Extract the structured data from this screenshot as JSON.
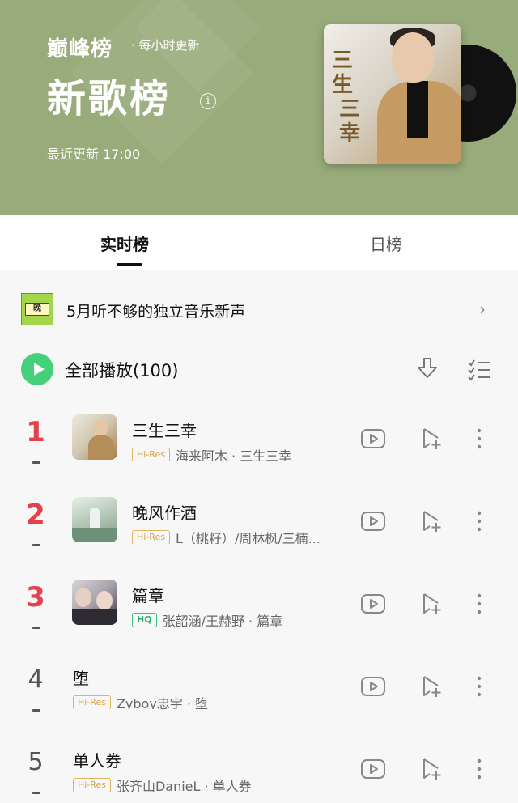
{
  "header": {
    "brand": "巅峰榜",
    "subtitle": "· 每小时更新",
    "title": "新歌榜",
    "info_icon": "info-icon",
    "updated": "最近更新 17:00",
    "bg_color": "#98ab7a"
  },
  "tabs": [
    {
      "label": "实时榜",
      "active": true
    },
    {
      "label": "日榜",
      "active": false
    }
  ],
  "banner": {
    "thumb_label": "晚",
    "text": "5月听不够的独立音乐新声"
  },
  "play_all": {
    "label": "全部播放(100)",
    "accent": "#45d07a"
  },
  "songs": [
    {
      "rank": "1",
      "title": "三生三幸",
      "quality": "Hi-Res",
      "artist": "海来阿木 · 三生三幸"
    },
    {
      "rank": "2",
      "title": "晚风作酒",
      "quality": "Hi-Res",
      "artist": "L（桃籽）/周林枫/三楠..."
    },
    {
      "rank": "3",
      "title": "篇章",
      "quality": "HQ",
      "artist": "张韶涵/王赫野 · 篇章"
    },
    {
      "rank": "4",
      "title": "堕",
      "quality": "Hi-Res",
      "artist": "Zyboy忠宇 · 堕"
    },
    {
      "rank": "5",
      "title": "单人券",
      "quality": "Hi-Res",
      "artist": "张齐山DanieL · 单人券"
    }
  ]
}
